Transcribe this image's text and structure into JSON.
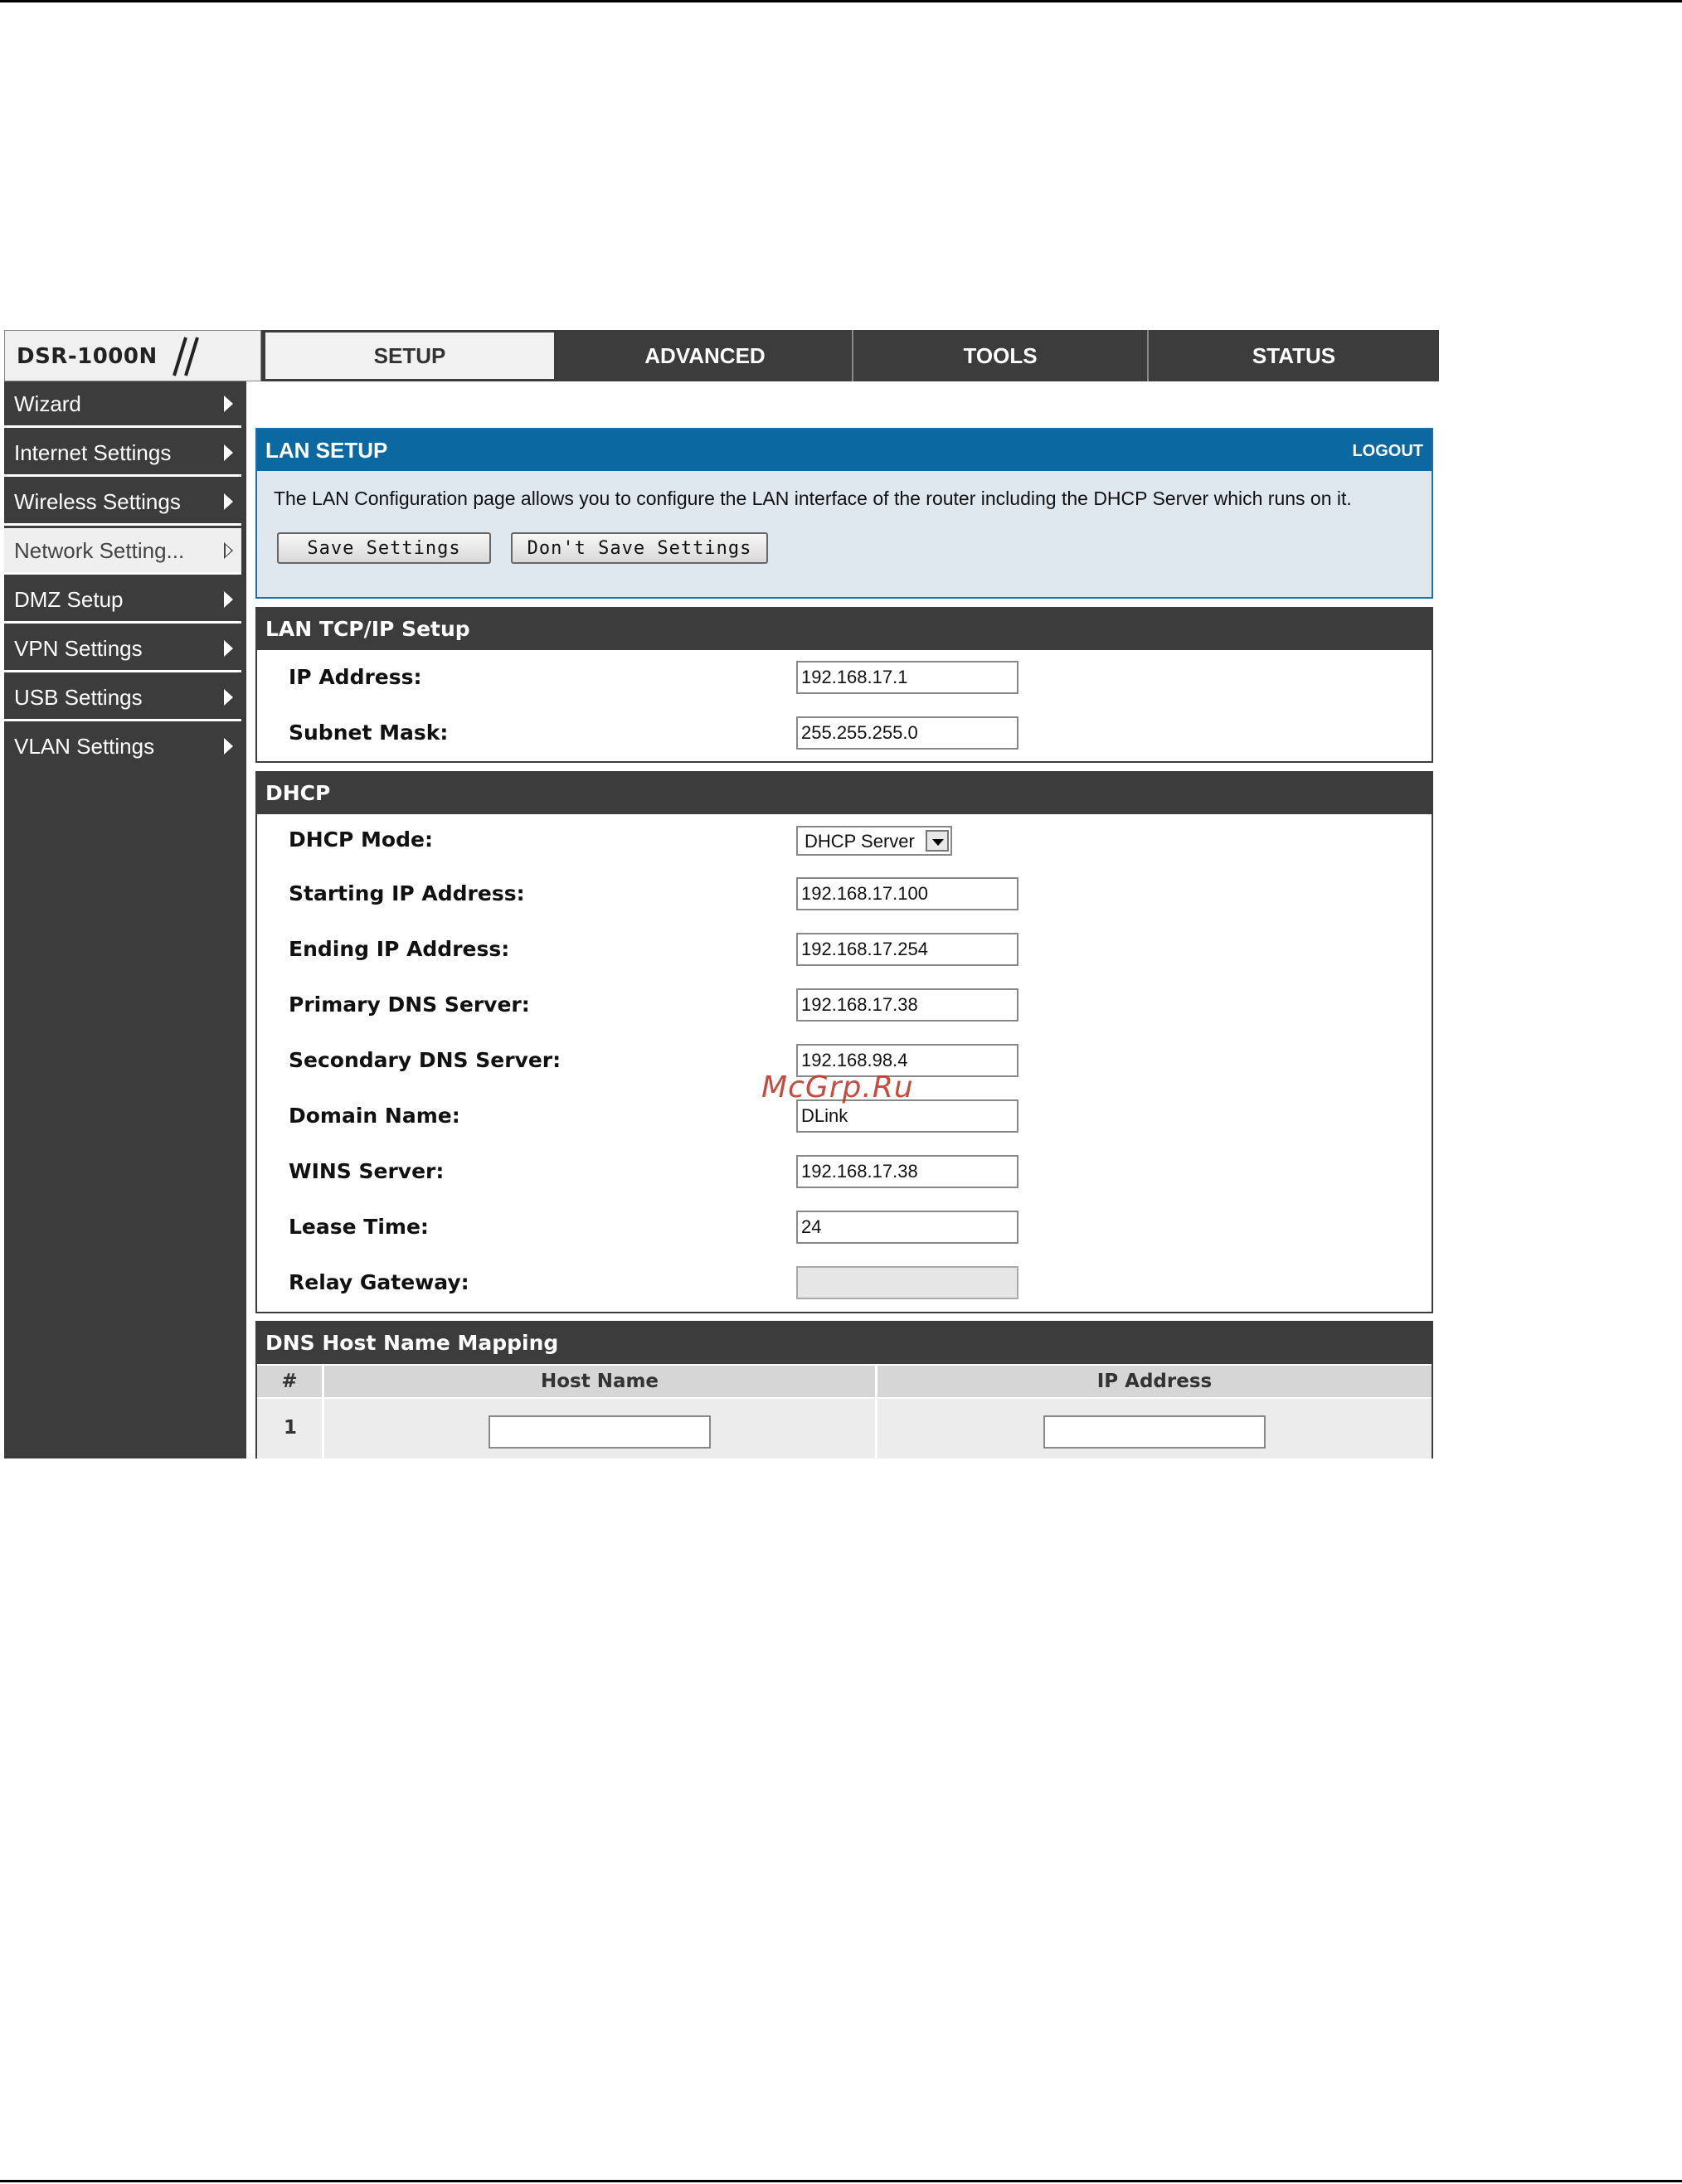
{
  "brand": {
    "model": "DSR-1000N"
  },
  "tabs": [
    "SETUP",
    "ADVANCED",
    "TOOLS",
    "STATUS"
  ],
  "sidebar": {
    "items": [
      {
        "label": "Wizard"
      },
      {
        "label": "Internet Settings"
      },
      {
        "label": "Wireless Settings"
      },
      {
        "label": "Network Setting..."
      },
      {
        "label": "DMZ Setup"
      },
      {
        "label": "VPN Settings"
      },
      {
        "label": "USB Settings"
      },
      {
        "label": "VLAN Settings"
      }
    ],
    "active": "Network Setting..."
  },
  "lan_setup": {
    "title": "LAN SETUP",
    "logout": "LOGOUT",
    "description": "The LAN Configuration page allows you to configure the LAN interface of the router including the DHCP Server which runs on it.",
    "save_label": "Save Settings",
    "dont_save_label": "Don't Save Settings"
  },
  "tcpip": {
    "title": "LAN TCP/IP Setup",
    "ip_label": "IP Address:",
    "ip_value": "192.168.17.1",
    "mask_label": "Subnet Mask:",
    "mask_value": "255.255.255.0"
  },
  "dhcp": {
    "title": "DHCP",
    "mode_label": "DHCP Mode:",
    "mode_value": "DHCP Server",
    "start_label": "Starting IP Address:",
    "start_value": "192.168.17.100",
    "end_label": "Ending IP Address:",
    "end_value": "192.168.17.254",
    "primary_dns_label": "Primary DNS Server:",
    "primary_dns_value": "192.168.17.38",
    "secondary_dns_label": "Secondary DNS Server:",
    "secondary_dns_value": "192.168.98.4",
    "domain_label": "Domain Name:",
    "domain_value": "DLink",
    "wins_label": "WINS Server:",
    "wins_value": "192.168.17.38",
    "lease_label": "Lease Time:",
    "lease_value": "24",
    "relay_label": "Relay Gateway:",
    "relay_value": ""
  },
  "dns_mapping": {
    "title": "DNS Host Name Mapping",
    "columns": [
      "#",
      "Host Name",
      "IP Address"
    ],
    "rows": [
      {
        "index": "1",
        "host": "",
        "ip": ""
      }
    ]
  },
  "watermark": "McGrp.Ru",
  "colors": {
    "header_blue": "#0c68a0",
    "dark_gray": "#3c3c3c",
    "panel_bg": "#dfe8ef"
  }
}
